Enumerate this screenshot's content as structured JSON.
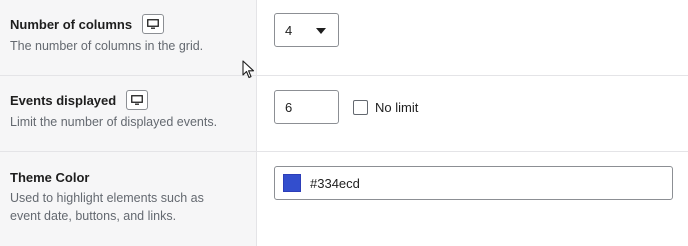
{
  "settings": [
    {
      "title": "Number of columns",
      "description": "The number of columns in the grid.",
      "control": {
        "type": "select",
        "value": "4"
      }
    },
    {
      "title": "Events displayed",
      "description": "Limit the number of displayed events.",
      "control": {
        "type": "number",
        "value": "6",
        "checkbox_label": "No limit",
        "checkbox_checked": false
      }
    },
    {
      "title": "Theme Color",
      "description_lines": [
        "Used to highlight elements such as",
        "event date, buttons, and links."
      ],
      "control": {
        "type": "color",
        "value": "#334ecd"
      }
    }
  ],
  "icons": {
    "responsive": "desktop-icon",
    "dropdown": "chevron-down-icon",
    "cursor": "mouse-pointer-icon"
  },
  "colors": {
    "swatch": "#334ecd",
    "left_panel_bg": "#f6f6f7"
  }
}
